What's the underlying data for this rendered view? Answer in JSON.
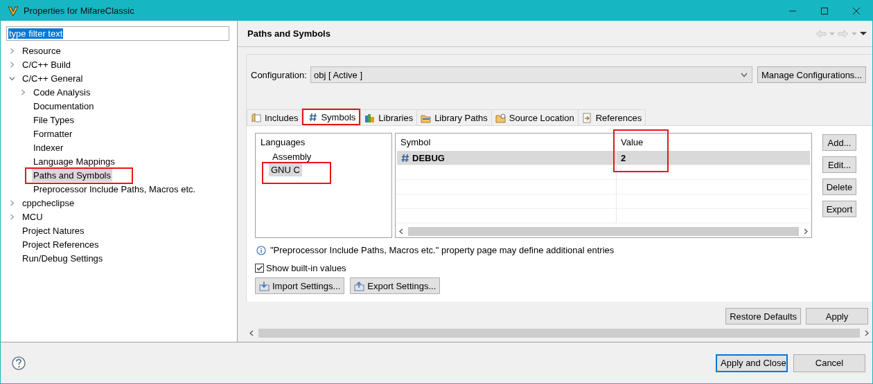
{
  "window": {
    "title": "Properties for MifareClassic"
  },
  "filter": {
    "value": "type filter text",
    "text_selected": true
  },
  "tree": [
    {
      "label": "Resource",
      "kind": "folder",
      "expanded": false,
      "selected": false,
      "annotated": false
    },
    {
      "label": "C/C++ Build",
      "kind": "folder",
      "expanded": false,
      "selected": false,
      "annotated": false
    },
    {
      "label": "C/C++ General",
      "kind": "folder",
      "expanded": true,
      "selected": false,
      "annotated": false,
      "children": [
        {
          "label": "Code Analysis",
          "kind": "folder",
          "expanded": false,
          "selected": false,
          "annotated": false
        },
        {
          "label": "Documentation",
          "kind": "leaf",
          "selected": false,
          "annotated": false
        },
        {
          "label": "File Types",
          "kind": "leaf",
          "selected": false,
          "annotated": false
        },
        {
          "label": "Formatter",
          "kind": "leaf",
          "selected": false,
          "annotated": false
        },
        {
          "label": "Indexer",
          "kind": "leaf",
          "selected": false,
          "annotated": false
        },
        {
          "label": "Language Mappings",
          "kind": "leaf",
          "selected": false,
          "annotated": false
        },
        {
          "label": "Paths and Symbols",
          "kind": "leaf",
          "selected": true,
          "annotated": true
        },
        {
          "label": "Preprocessor Include Paths, Macros etc.",
          "kind": "leaf",
          "selected": false,
          "annotated": false
        }
      ]
    },
    {
      "label": "cppcheclipse",
      "kind": "folder",
      "expanded": false,
      "selected": false,
      "annotated": false
    },
    {
      "label": "MCU",
      "kind": "folder",
      "expanded": false,
      "selected": false,
      "annotated": false
    },
    {
      "label": "Project Natures",
      "kind": "leaf",
      "selected": false,
      "annotated": false
    },
    {
      "label": "Project References",
      "kind": "leaf",
      "selected": false,
      "annotated": false
    },
    {
      "label": "Run/Debug Settings",
      "kind": "leaf",
      "selected": false,
      "annotated": false
    }
  ],
  "page": {
    "title": "Paths and Symbols"
  },
  "configuration": {
    "label": "Configuration:",
    "value": "obj  [ Active ]",
    "button": "Manage Configurations..."
  },
  "tabs": [
    {
      "label": "Includes",
      "selected": false,
      "annotated": false
    },
    {
      "label": "Symbols",
      "selected": true,
      "annotated": true
    },
    {
      "label": "Libraries",
      "selected": false,
      "annotated": false
    },
    {
      "label": "Library Paths",
      "selected": false,
      "annotated": false
    },
    {
      "label": "Source Location",
      "selected": false,
      "annotated": false
    },
    {
      "label": "References",
      "selected": false,
      "annotated": false
    }
  ],
  "languages": {
    "heading": "Languages",
    "items": [
      {
        "label": "Assembly",
        "selected": false,
        "annotated": false
      },
      {
        "label": "GNU C",
        "selected": true,
        "annotated": true
      }
    ]
  },
  "table": {
    "columns": [
      {
        "label": "Symbol",
        "annotated": false
      },
      {
        "label": "Value",
        "annotated": true
      }
    ],
    "rows": [
      {
        "symbol": "DEBUG",
        "value": "2",
        "selected": true
      }
    ]
  },
  "side_buttons": [
    "Add...",
    "Edit...",
    "Delete",
    "Export"
  ],
  "note": "\"Preprocessor Include Paths, Macros etc.\" property page may define additional entries",
  "show_builtin": {
    "label": "Show built-in values",
    "checked": true
  },
  "settings_buttons": [
    "Import Settings...",
    "Export Settings..."
  ],
  "page_buttons": [
    "Restore Defaults",
    "Apply"
  ],
  "footer_buttons": [
    {
      "label": "Apply and Close",
      "kind": "default"
    },
    {
      "label": "Cancel",
      "kind": "normal"
    }
  ]
}
